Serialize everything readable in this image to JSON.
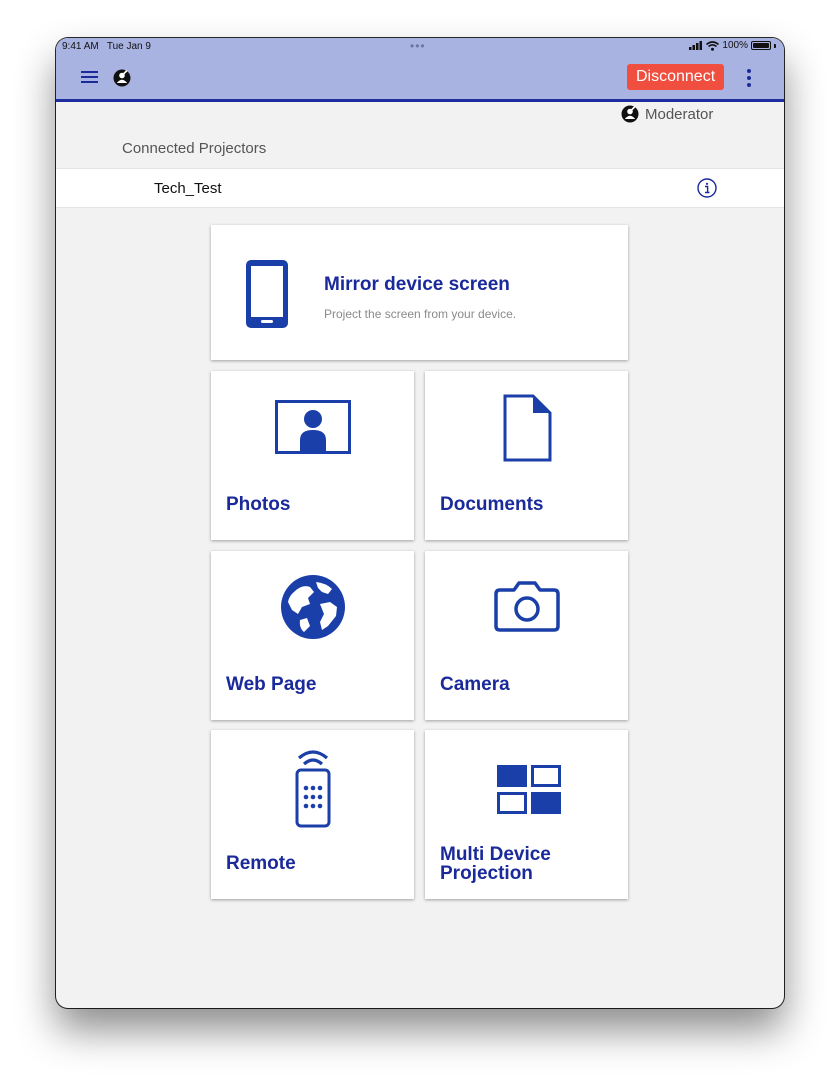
{
  "status_bar": {
    "time": "9:41 AM",
    "date": "Tue Jan 9",
    "battery": "100%"
  },
  "navbar": {
    "disconnect_label": "Disconnect"
  },
  "role": {
    "label": "Moderator"
  },
  "projectors": {
    "section_title": "Connected Projectors",
    "items": [
      {
        "name": "Tech_Test"
      }
    ]
  },
  "tiles": {
    "mirror": {
      "title": "Mirror device screen",
      "subtitle": "Project the screen from your device.",
      "icon": "phone-icon"
    },
    "photos": {
      "title": "Photos",
      "icon": "photo-icon"
    },
    "documents": {
      "title": "Documents",
      "icon": "document-icon"
    },
    "web": {
      "title": "Web Page",
      "icon": "globe-icon"
    },
    "camera": {
      "title": "Camera",
      "icon": "camera-icon"
    },
    "remote": {
      "title": "Remote",
      "icon": "remote-icon"
    },
    "multi": {
      "title_line1": "Multi Device",
      "title_line2": "Projection",
      "icon": "grid-icon"
    }
  },
  "colors": {
    "accent": "#1b2a9a",
    "navbar": "#a9b3e1",
    "disconnect": "#f04e3e",
    "background": "#f2f2f2"
  }
}
